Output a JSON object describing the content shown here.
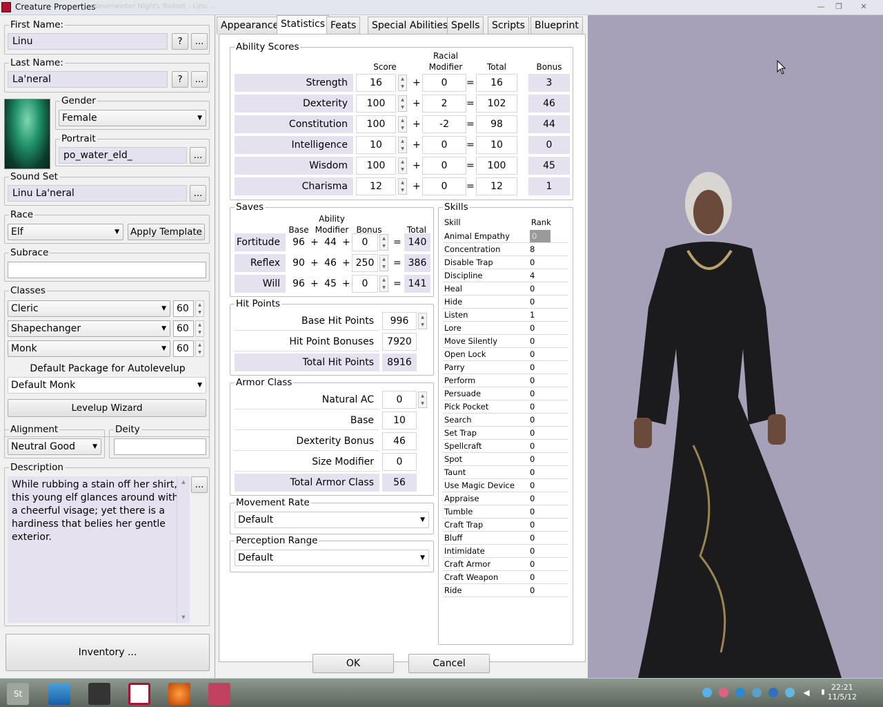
{
  "window": {
    "title": "Creature Properties",
    "ghost_title": "Neverwinter Nights Toolset - Linu ...",
    "minimize": "—",
    "maximize": "❐",
    "close": "✕"
  },
  "left": {
    "first_name_label": "First Name:",
    "first_name": "Linu",
    "last_name_label": "Last Name:",
    "last_name": "La'neral",
    "help_btn": "?",
    "more_btn": "...",
    "gender_label": "Gender",
    "gender": "Female",
    "portrait_label": "Portrait",
    "portrait": "po_water_eld_",
    "soundset_label": "Sound Set",
    "soundset": "Linu La'neral",
    "race_label": "Race",
    "race": "Elf",
    "apply_template": "Apply Template",
    "subrace_label": "Subrace",
    "subrace": "",
    "classes_label": "Classes",
    "classes": [
      {
        "name": "Cleric",
        "level": "60"
      },
      {
        "name": "Shapechanger",
        "level": "60"
      },
      {
        "name": "Monk",
        "level": "60"
      }
    ],
    "default_package_label": "Default Package for Autolevelup",
    "default_package": "Default Monk",
    "levelup_wizard": "Levelup Wizard",
    "alignment_label": "Alignment",
    "alignment": "Neutral Good",
    "deity_label": "Deity",
    "deity": "",
    "description_label": "Description",
    "description": "While rubbing a stain off her shirt, this young elf glances around with a cheerful visage; yet there is a hardiness that belies her gentle exterior.",
    "inventory": "Inventory ..."
  },
  "tabs": [
    "Appearance",
    "Statistics",
    "Feats",
    "Special Abilities",
    "Spells",
    "Scripts",
    "Blueprint"
  ],
  "abilities": {
    "label": "Ability Scores",
    "headers": {
      "score": "Score",
      "racial": "Racial\nModifier",
      "total": "Total",
      "bonus": "Bonus"
    },
    "rows": [
      {
        "name": "Strength",
        "score": "16",
        "racial": "0",
        "total": "16",
        "bonus": "3"
      },
      {
        "name": "Dexterity",
        "score": "100",
        "racial": "2",
        "total": "102",
        "bonus": "46"
      },
      {
        "name": "Constitution",
        "score": "100",
        "racial": "-2",
        "total": "98",
        "bonus": "44"
      },
      {
        "name": "Intelligence",
        "score": "10",
        "racial": "0",
        "total": "10",
        "bonus": "0"
      },
      {
        "name": "Wisdom",
        "score": "100",
        "racial": "0",
        "total": "100",
        "bonus": "45"
      },
      {
        "name": "Charisma",
        "score": "12",
        "racial": "0",
        "total": "12",
        "bonus": "1"
      }
    ]
  },
  "saves": {
    "label": "Saves",
    "headers": {
      "base": "Base",
      "ability": "Ability\nModifier",
      "bonus": "Bonus",
      "total": "Total"
    },
    "rows": [
      {
        "name": "Fortitude",
        "base": "96",
        "ability": "44",
        "bonus": "0",
        "total": "140"
      },
      {
        "name": "Reflex",
        "base": "90",
        "ability": "46",
        "bonus": "250",
        "total": "386"
      },
      {
        "name": "Will",
        "base": "96",
        "ability": "45",
        "bonus": "0",
        "total": "141"
      }
    ]
  },
  "hit_points": {
    "label": "Hit Points",
    "base_label": "Base Hit Points",
    "base": "996",
    "bonus_label": "Hit Point Bonuses",
    "bonus": "7920",
    "total_label": "Total Hit Points",
    "total": "8916"
  },
  "armor": {
    "label": "Armor Class",
    "natural_label": "Natural AC",
    "natural": "0",
    "base_label": "Base",
    "base": "10",
    "dex_label": "Dexterity Bonus",
    "dex": "46",
    "size_label": "Size Modifier",
    "size": "0",
    "total_label": "Total Armor Class",
    "total": "56"
  },
  "movement": {
    "label": "Movement Rate",
    "value": "Default"
  },
  "perception": {
    "label": "Perception Range",
    "value": "Default"
  },
  "skills": {
    "label": "Skills",
    "col_skill": "Skill",
    "col_rank": "Rank",
    "rows": [
      {
        "name": "Animal Empathy",
        "rank": "0"
      },
      {
        "name": "Concentration",
        "rank": "8"
      },
      {
        "name": "Disable Trap",
        "rank": "0"
      },
      {
        "name": "Discipline",
        "rank": "4"
      },
      {
        "name": "Heal",
        "rank": "0"
      },
      {
        "name": "Hide",
        "rank": "0"
      },
      {
        "name": "Listen",
        "rank": "1"
      },
      {
        "name": "Lore",
        "rank": "0"
      },
      {
        "name": "Move Silently",
        "rank": "0"
      },
      {
        "name": "Open Lock",
        "rank": "0"
      },
      {
        "name": "Parry",
        "rank": "0"
      },
      {
        "name": "Perform",
        "rank": "0"
      },
      {
        "name": "Persuade",
        "rank": "0"
      },
      {
        "name": "Pick Pocket",
        "rank": "0"
      },
      {
        "name": "Search",
        "rank": "0"
      },
      {
        "name": "Set Trap",
        "rank": "0"
      },
      {
        "name": "Spellcraft",
        "rank": "0"
      },
      {
        "name": "Spot",
        "rank": "0"
      },
      {
        "name": "Taunt",
        "rank": "0"
      },
      {
        "name": "Use Magic Device",
        "rank": "0"
      },
      {
        "name": "Appraise",
        "rank": "0"
      },
      {
        "name": "Tumble",
        "rank": "0"
      },
      {
        "name": "Craft Trap",
        "rank": "0"
      },
      {
        "name": "Bluff",
        "rank": "0"
      },
      {
        "name": "Intimidate",
        "rank": "0"
      },
      {
        "name": "Craft Armor",
        "rank": "0"
      },
      {
        "name": "Craft Weapon",
        "rank": "0"
      },
      {
        "name": "Ride",
        "rank": "0"
      }
    ]
  },
  "dialog": {
    "ok": "OK",
    "cancel": "Cancel"
  },
  "taskbar": {
    "start": "St",
    "time": "22:21",
    "date": "11/5/12"
  },
  "colors": {
    "label_bg": "#e6e1ee",
    "preview_bg": "#a6a1b8"
  }
}
